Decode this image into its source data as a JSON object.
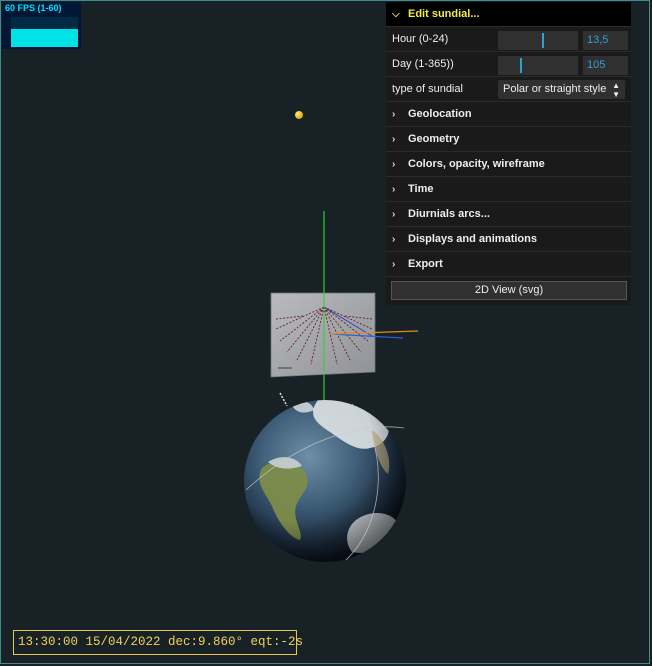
{
  "fps": {
    "label": "60 FPS (1-60)",
    "level": 0.6
  },
  "gui": {
    "folder_title": "Edit sundial...",
    "hour": {
      "label": "Hour  (0-24)",
      "value": "13,5",
      "level": 0.5625
    },
    "day": {
      "label": "Day (1-365))",
      "value": "105",
      "level": 0.285
    },
    "type": {
      "label": "type of sundial",
      "selected": "Polar or straight style"
    },
    "folders": [
      "Geolocation",
      "Geometry",
      "Colors, opacity, wireframe",
      "Time",
      "Diurnials arcs...",
      "Displays and animations",
      "Export"
    ],
    "button": "2D View (svg)"
  },
  "status": "13:30:00 15/04/2022 dec:9.860° eqt:-2s",
  "colors": {
    "background": "#182226",
    "accent": "#2fa1d6",
    "title": "#f5e94a",
    "status": "#efd25a",
    "fps": "#00e2e6"
  }
}
